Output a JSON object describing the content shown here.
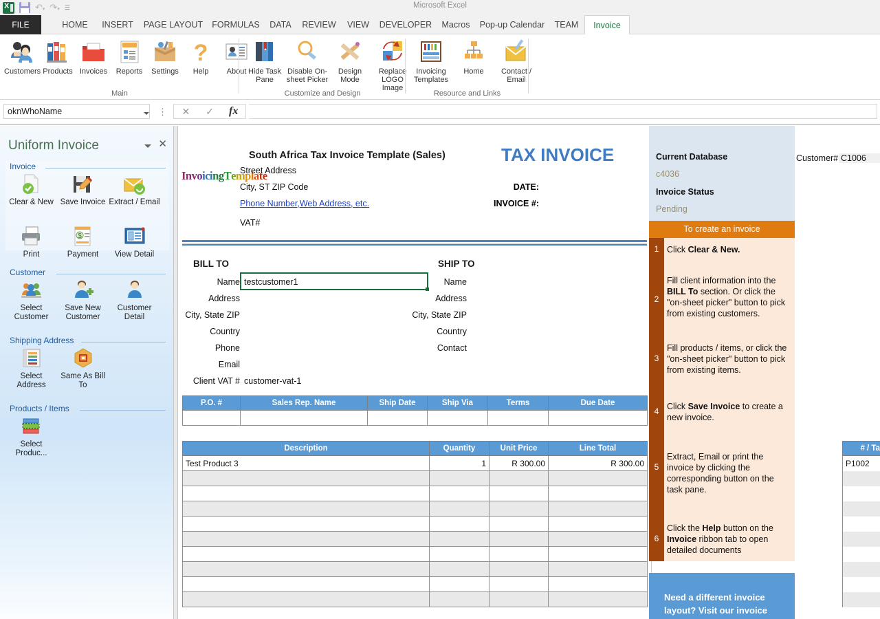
{
  "window": {
    "title": "Microsoft Excel",
    "quick_access": [
      "excel-logo",
      "save-icon",
      "undo-icon",
      "redo-icon",
      "customize-qat-icon"
    ]
  },
  "ribbon": {
    "tabs": [
      {
        "label": "FILE",
        "active": false,
        "file": true
      },
      {
        "label": "HOME",
        "active": false
      },
      {
        "label": "INSERT",
        "active": false
      },
      {
        "label": "PAGE LAYOUT",
        "active": false
      },
      {
        "label": "FORMULAS",
        "active": false
      },
      {
        "label": "DATA",
        "active": false
      },
      {
        "label": "REVIEW",
        "active": false
      },
      {
        "label": "VIEW",
        "active": false
      },
      {
        "label": "DEVELOPER",
        "active": false
      },
      {
        "label": "Macros",
        "active": false
      },
      {
        "label": "Pop-up Calendar",
        "active": false
      },
      {
        "label": "TEAM",
        "active": false
      },
      {
        "label": "Invoice",
        "active": true
      }
    ],
    "groups": [
      {
        "name": "Main",
        "items": [
          {
            "label": "Customers",
            "icon": "customers-icon"
          },
          {
            "label": "Products",
            "icon": "products-icon"
          },
          {
            "label": "Invoices",
            "icon": "invoices-icon"
          },
          {
            "label": "Reports",
            "icon": "reports-icon"
          },
          {
            "label": "Settings",
            "icon": "settings-icon"
          },
          {
            "label": "Help",
            "icon": "help-icon"
          },
          {
            "label": "About",
            "icon": "about-icon"
          }
        ]
      },
      {
        "name": "Customize and Design",
        "items": [
          {
            "label": "Hide Task Pane",
            "icon": "hide-task-pane-icon"
          },
          {
            "label": "Disable On-sheet Picker",
            "icon": "disable-picker-icon"
          },
          {
            "label": "Design Mode",
            "icon": "design-mode-icon"
          },
          {
            "label": "Replace LOGO Image",
            "icon": "replace-logo-icon"
          }
        ]
      },
      {
        "name": "Resource and Links",
        "items": [
          {
            "label": "Invoicing Templates",
            "icon": "invoicing-templates-icon"
          },
          {
            "label": "Home",
            "icon": "home-icon"
          },
          {
            "label": "Contact / Email",
            "icon": "contact-email-icon"
          }
        ]
      }
    ]
  },
  "formula_bar": {
    "name_box_value": "oknWhoName",
    "formula_value": "",
    "cancel_icon": "✕",
    "enter_icon": "✓",
    "function_icon": "fx"
  },
  "task_pane": {
    "title": "Uniform Invoice",
    "sections": [
      {
        "name": "Invoice",
        "items": [
          {
            "label": "Clear & New",
            "icon": "clear-new-icon"
          },
          {
            "label": "Save Invoice",
            "icon": "save-invoice-icon"
          },
          {
            "label": "Extract / Email",
            "icon": "extract-email-icon"
          },
          {
            "label": "Print",
            "icon": "print-icon"
          },
          {
            "label": "Payment",
            "icon": "payment-icon"
          },
          {
            "label": "View Detail",
            "icon": "view-detail-icon"
          }
        ]
      },
      {
        "name": "Customer",
        "items": [
          {
            "label": "Select Customer",
            "icon": "select-customer-icon"
          },
          {
            "label": "Save New Customer",
            "icon": "save-new-customer-icon"
          },
          {
            "label": "Customer Detail",
            "icon": "customer-detail-icon"
          }
        ]
      },
      {
        "name": "Shipping Address",
        "items": [
          {
            "label": "Select Address",
            "icon": "select-address-icon"
          },
          {
            "label": "Same As Bill To",
            "icon": "same-as-bill-to-icon"
          }
        ]
      },
      {
        "name": "Products / Items",
        "items": [
          {
            "label": "Select Produc...",
            "icon": "select-product-icon"
          }
        ]
      }
    ]
  },
  "invoice": {
    "logo_text": "InvoicingTemplate",
    "company_title": "South Africa Tax Invoice Template (Sales)",
    "doc_title": "TAX INVOICE",
    "address_lines": [
      {
        "text": "Street Address",
        "link": false
      },
      {
        "text": "City, ST  ZIP Code",
        "link": false
      },
      {
        "text": "Phone Number,Web Address, etc.",
        "link": true
      },
      {
        "text": "VAT#",
        "link": false
      }
    ],
    "date_label": "DATE:",
    "date_value": "",
    "invoice_no_label": "INVOICE #:",
    "invoice_no_value": "",
    "bill_to": {
      "heading": "BILL TO",
      "fields": [
        {
          "label": "Name",
          "value": "testcustomer1"
        },
        {
          "label": "Address",
          "value": ""
        },
        {
          "label": "City, State ZIP",
          "value": ""
        },
        {
          "label": "Country",
          "value": ""
        },
        {
          "label": "Phone",
          "value": ""
        },
        {
          "label": "Email",
          "value": ""
        },
        {
          "label": "Client VAT #",
          "value": "customer-vat-1"
        }
      ]
    },
    "ship_to": {
      "heading": "SHIP TO",
      "fields": [
        {
          "label": "Name",
          "value": ""
        },
        {
          "label": "Address",
          "value": ""
        },
        {
          "label": "City, State ZIP",
          "value": ""
        },
        {
          "label": "Country",
          "value": ""
        },
        {
          "label": "Contact",
          "value": ""
        }
      ]
    },
    "meta_table": {
      "headers": [
        "P.O. #",
        "Sales Rep. Name",
        "Ship Date",
        "Ship Via",
        "Terms",
        "Due Date"
      ],
      "row": [
        "",
        "",
        "",
        "",
        "",
        ""
      ]
    },
    "items_table": {
      "headers": [
        "Description",
        "Quantity",
        "Unit Price",
        "Line Total"
      ],
      "rows": [
        {
          "description": "Test Product 3",
          "quantity": "1",
          "unit_price": "R 300.00",
          "line_total": "R 300.00"
        },
        {
          "description": "",
          "quantity": "",
          "unit_price": "",
          "line_total": ""
        },
        {
          "description": "",
          "quantity": "",
          "unit_price": "",
          "line_total": ""
        },
        {
          "description": "",
          "quantity": "",
          "unit_price": "",
          "line_total": ""
        },
        {
          "description": "",
          "quantity": "",
          "unit_price": "",
          "line_total": ""
        },
        {
          "description": "",
          "quantity": "",
          "unit_price": "",
          "line_total": ""
        },
        {
          "description": "",
          "quantity": "",
          "unit_price": "",
          "line_total": ""
        },
        {
          "description": "",
          "quantity": "",
          "unit_price": "",
          "line_total": ""
        },
        {
          "description": "",
          "quantity": "",
          "unit_price": "",
          "line_total": ""
        },
        {
          "description": "",
          "quantity": "",
          "unit_price": "",
          "line_total": ""
        }
      ]
    }
  },
  "help_panel": {
    "current_database_label": "Current Database",
    "current_database_value": "c4036",
    "invoice_status_label": "Invoice Status",
    "invoice_status_value": "Pending",
    "bar_title": "To create an invoice",
    "steps": [
      {
        "num": "1",
        "html": "Click <b>Clear &amp; New.</b>"
      },
      {
        "num": "2",
        "html": "Fill client information into the <b>BILL To</b> section. Or click the \"on-sheet picker\" button to pick from existing customers."
      },
      {
        "num": "3",
        "html": "Fill products / items, or click the \"on-sheet picker\" button to pick from existing items."
      },
      {
        "num": "4",
        "html": "Click <b>Save Invoice</b> to create a new invoice."
      },
      {
        "num": "5",
        "html": "Extract, Email or print the invoice by clicking the corresponding button on the task pane."
      },
      {
        "num": "6",
        "html": "Click the <b>Help</b> button on the <b>Invoice</b> ribbon tab to open detailed documents"
      }
    ],
    "promo_text": "Need a different invoice layout? Visit our invoice"
  },
  "far_right": {
    "customer_label": "Customer#",
    "customer_value": "C1006",
    "product_header": "# / Ta",
    "product_rows": [
      "P1002",
      "",
      "",
      "",
      "",
      "",
      "",
      "",
      "",
      ""
    ]
  },
  "colors": {
    "excel_green": "#217346",
    "accent_blue": "#5b9bd5",
    "tax_invoice_blue": "#3f7bc4",
    "orange_bar": "#e07b10",
    "orange_numcol": "#a0460d",
    "help_body": "#fde9d9",
    "help_top": "#dce6f1",
    "selection_green": "#1b6d3e"
  }
}
